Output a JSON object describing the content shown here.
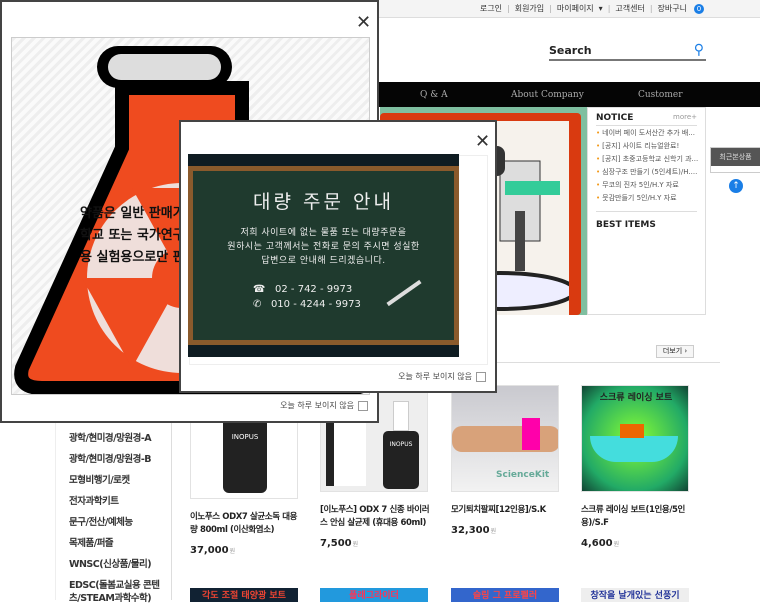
{
  "topbar": {
    "links": [
      "로그인",
      "회원가입",
      "마이페이지",
      "고객센터",
      "장바구니"
    ],
    "cart_count": "0"
  },
  "search": {
    "label": "Search"
  },
  "nav": {
    "items": [
      "Q & A",
      "About Company",
      "Customer"
    ]
  },
  "notice": {
    "title": "NOTICE",
    "more": "more+",
    "items": [
      "네이버 페이 도서산간 추가 배...",
      "[공지] 사이트 리뉴얼완료!",
      "[공지] 초중고등학교 신학기 과...",
      "심장구조 만들기 (5인세트)/H....",
      "무코의 진자 5인/H.Y 자료",
      "뭇감만들기 5인/H.Y 자료"
    ],
    "best": "BEST ITEMS"
  },
  "quick": {
    "recent": "최근본상품",
    "up": "↑"
  },
  "more_button": "더보기 ›",
  "categories": [
    "광학/현미경/망원경-A",
    "광학/현미경/망원경-B",
    "모형비행기/로켓",
    "전자과학키트",
    "문구/전산/예체능",
    "목제품/퍼즐",
    "WNSC(신상품/물리)",
    "EDSC(돌봄교실용 콘텐츠/STEAM과학수학)"
  ],
  "products": [
    {
      "name": "이노푸스 ODX7 살균소독 대용량 800ml (이산화염소)",
      "price": "37,000",
      "unit": "원",
      "brand": "INOPUS"
    },
    {
      "name": "[이노푸스] ODX 7 신종 바이러스 안심 살균제 (휴대용 60ml)",
      "price": "7,500",
      "unit": "원",
      "brand": "INOPUS"
    },
    {
      "name": "모기퇴치팔찌[12인용]/S.K",
      "price": "32,300",
      "unit": "원",
      "brand": "ScienceKit"
    },
    {
      "name": "스크류 레이싱 보트(1인용/5인용)/S.F",
      "price": "4,600",
      "unit": "원",
      "brand": "스크류 레이싱 보트"
    }
  ],
  "row2_titles": [
    "각도 조절 태양광 보트",
    "플래그라이더",
    "슬링 그 프로펠러",
    "창작을 날개있는 선풍기"
  ],
  "popup1": {
    "text_lines": [
      "약품은 일반 판매가",
      "학교 또는 국가연구",
      "용 실험용으로만 판"
    ],
    "dont_show": "오늘 하루 보이지 않음",
    "close": "✕"
  },
  "popup2": {
    "title": "대량 주문 안내",
    "body": [
      "저희 사이트에 없는 물품 또는 대량주문을",
      "원하시는 고객께서는 전화로 문의 주시면 성실한",
      "답변으로 안내해 드리겠습니다."
    ],
    "phones": [
      "02 - 742 - 9973",
      "010 - 4244 - 9973"
    ],
    "dont_show": "오늘 하루 보이지 않음",
    "close": "✕"
  },
  "colors": {
    "accent": "#1a7ee6",
    "flask": "#ef4b1f"
  }
}
